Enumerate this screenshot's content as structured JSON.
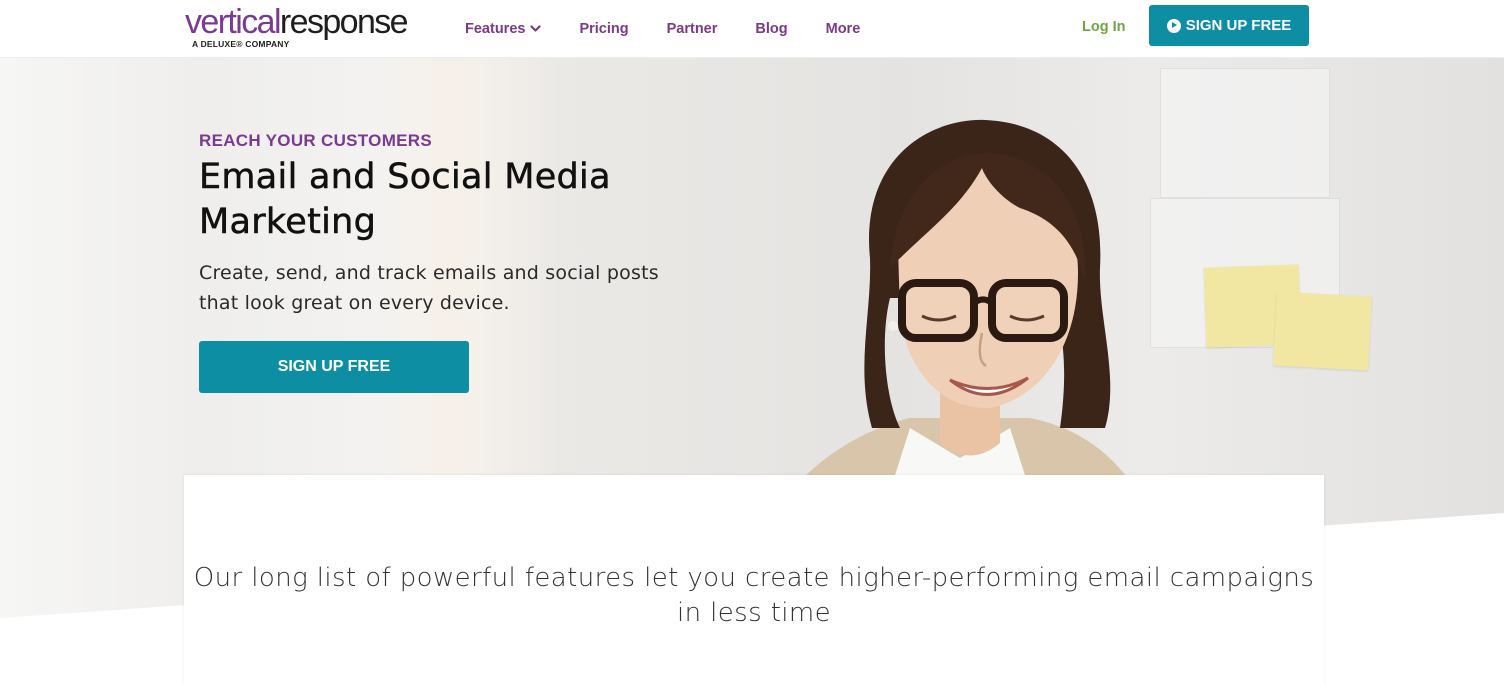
{
  "brand": {
    "logo_part1": "vertical",
    "logo_part2": "response",
    "logo_sub": "A DELUXE® COMPANY",
    "purple": "#7a3a92",
    "teal": "#0e8ea3",
    "green": "#6fa544"
  },
  "nav": {
    "items": [
      {
        "label": "Features",
        "has_dropdown": true
      },
      {
        "label": "Pricing"
      },
      {
        "label": "Partner"
      },
      {
        "label": "Blog"
      },
      {
        "label": "More"
      }
    ],
    "login_label": "Log In",
    "cta_label": "SIGN UP FREE",
    "cta_icon": "play-circle-icon"
  },
  "hero": {
    "eyebrow": "REACH YOUR CUSTOMERS",
    "headline": "Email and Social Media Marketing",
    "subcopy": "Create, send, and track emails and social posts that look great on every device.",
    "cta_label": "SIGN UP FREE"
  },
  "features_intro": {
    "text": "Our long list of powerful features let you create higher-performing email campaigns in less time"
  }
}
